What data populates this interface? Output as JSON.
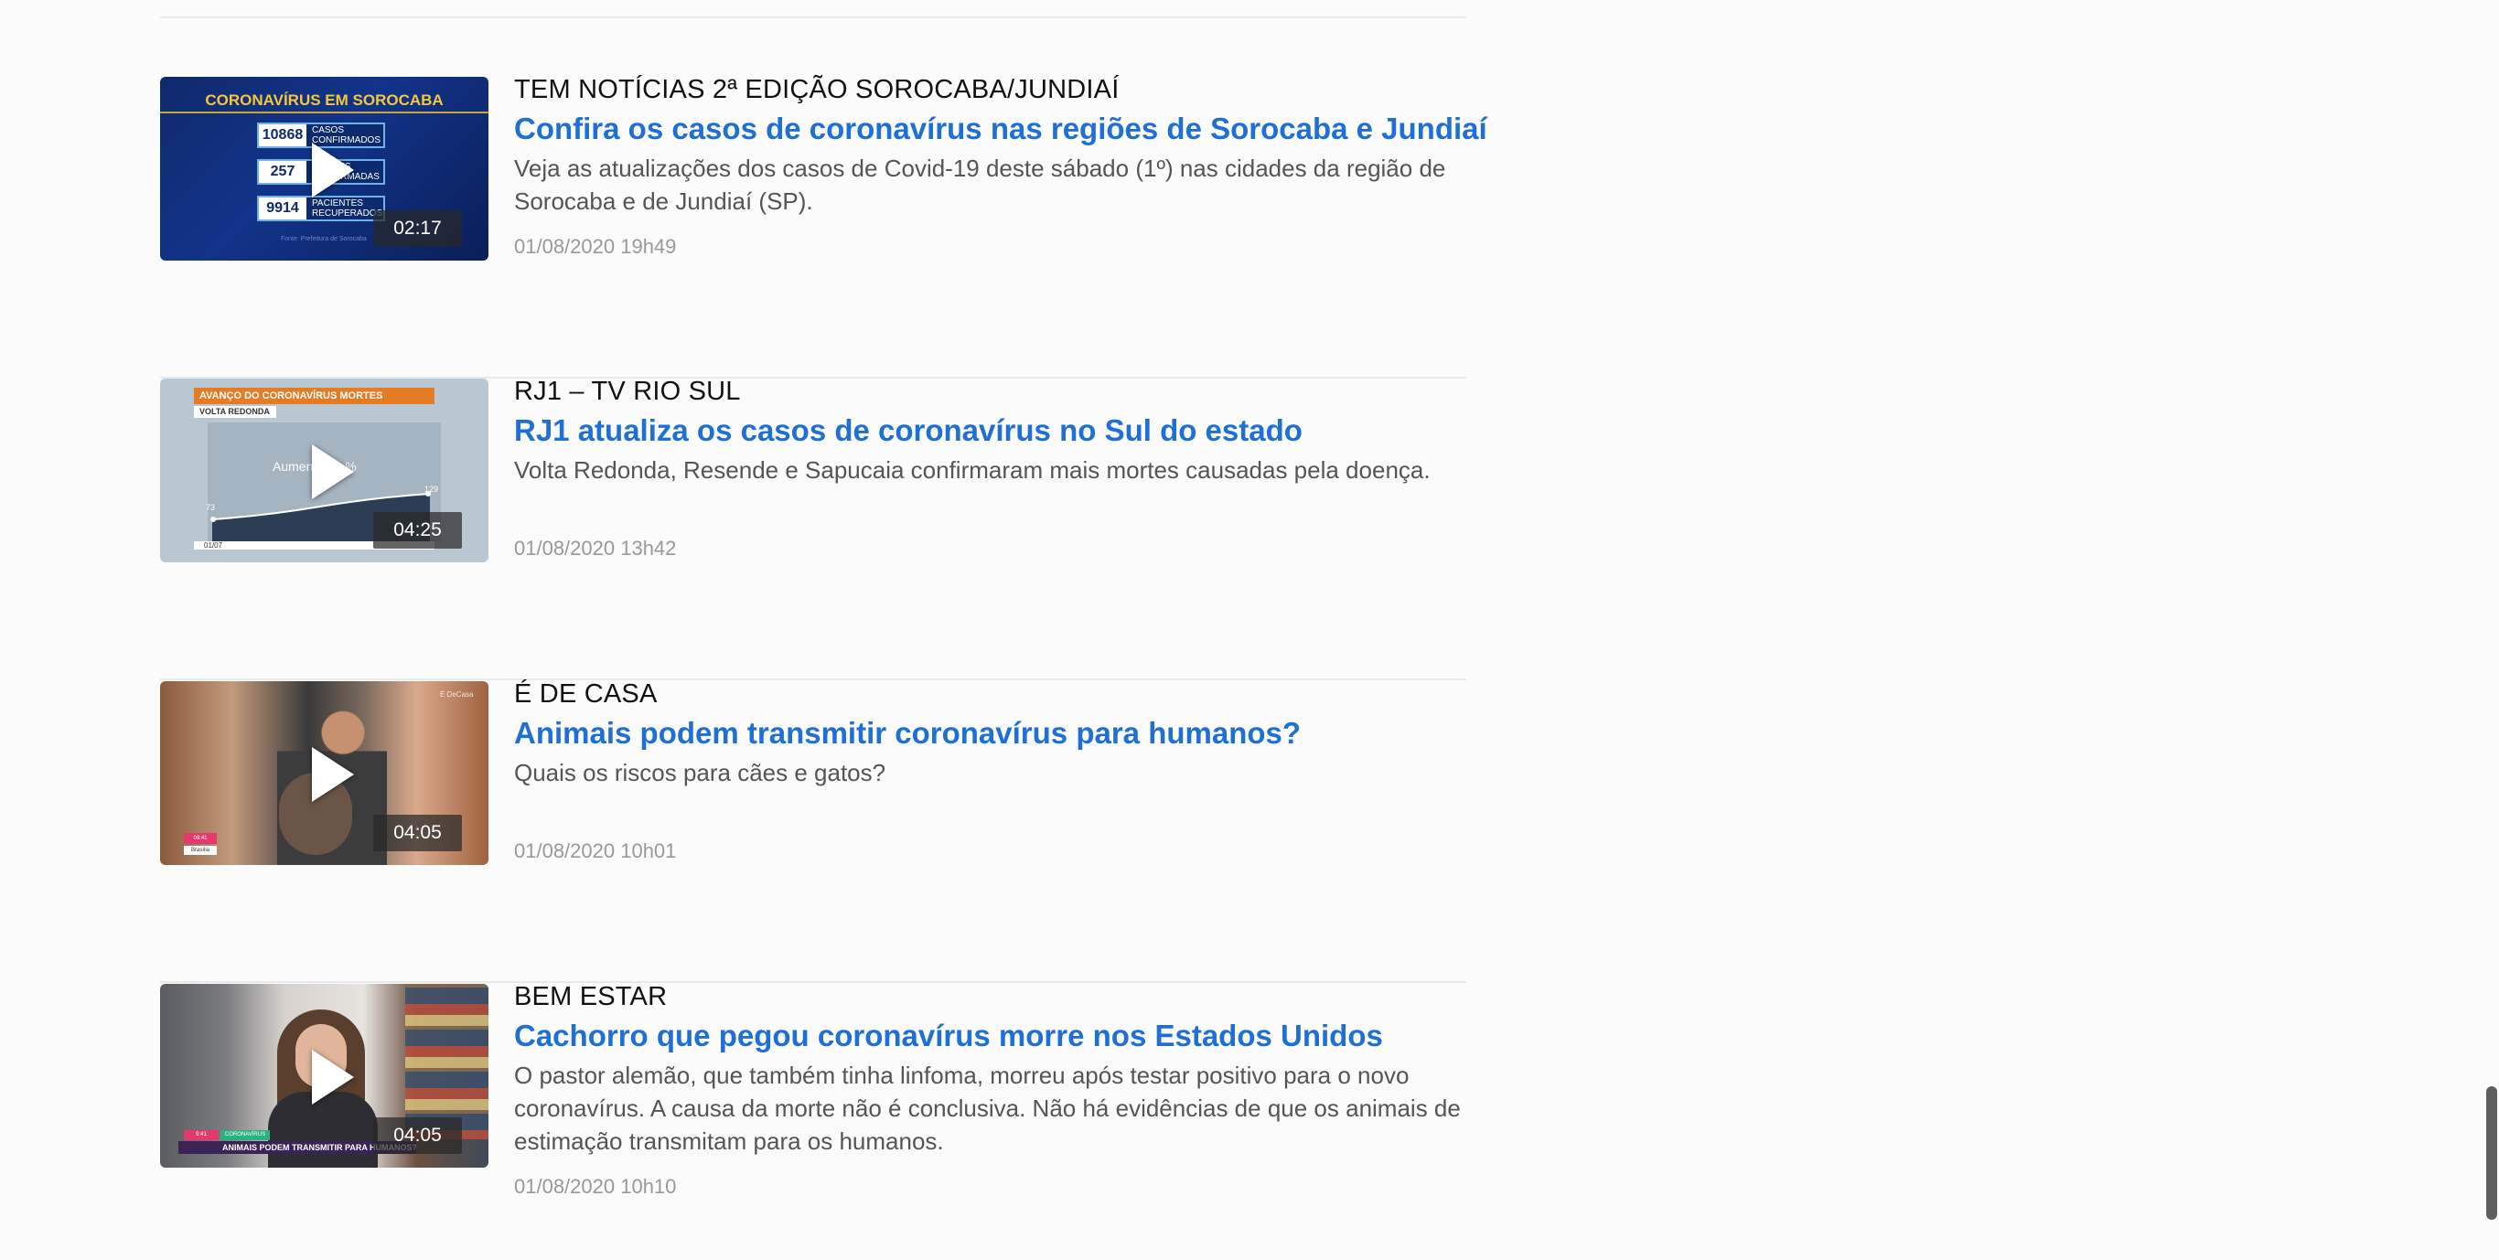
{
  "feed": {
    "items": [
      {
        "section": "TEM NOTÍCIAS 2ª EDIÇÃO SOROCABA/JUNDIAÍ",
        "headline": "Confira os casos de coronavírus nas regiões de Sorocaba e Jundiaí",
        "summary": "Veja as atualizações dos casos de Covid-19 deste sábado (1º) nas cidades da região de Sorocaba e de Jundiaí (SP).",
        "date": "01/08/2020 19h49",
        "duration": "02:17",
        "thumbnail": {
          "title": "CORONAVÍRUS EM SOROCABA",
          "stats": [
            {
              "value": "10868",
              "label": "CASOS CONFIRMADOS"
            },
            {
              "value": "257",
              "label": "MORTES CONFIRMADAS"
            },
            {
              "value": "9914",
              "label": "PACIENTES RECUPERADOS"
            }
          ],
          "source": "Fonte: Prefeitura de Sorocaba"
        }
      },
      {
        "section": "RJ1 – TV RIO SUL",
        "headline": "RJ1 atualiza os casos de coronavírus no Sul do estado",
        "summary": "Volta Redonda, Resende e Sapucaia confirmaram mais mortes causadas pela doença.",
        "date": "01/08/2020 13h42",
        "duration": "04:25",
        "thumbnail": {
          "banner": "AVANÇO DO CORONAVÍRUS MORTES",
          "city": "VOLTA REDONDA",
          "caption": "Aumento 76 %",
          "start_value": "73",
          "end_value": "129",
          "axis_label": "01/07"
        }
      },
      {
        "section": "É DE CASA",
        "headline": "Animais podem transmitir coronavírus para humanos?",
        "summary": "Quais os riscos para cães e gatos?",
        "date": "01/08/2020 10h01",
        "duration": "04:05",
        "thumbnail": {
          "watermark": "É DeCasa",
          "tag_time": "09:41",
          "tag_label": "Brasília"
        }
      },
      {
        "section": "BEM ESTAR",
        "headline": "Cachorro que pegou coronavírus morre nos Estados Unidos",
        "summary": "O pastor alemão, que também tinha linfoma, morreu após testar positivo para o novo coronavírus. A causa da morte não é conclusiva. Não há evidências de que os animais de estimação transmitam para os humanos.",
        "date": "01/08/2020 10h10",
        "duration": "04:05",
        "thumbnail": {
          "strip": "ANIMAIS PODEM TRANSMITIR PARA HUMANOS?",
          "tag_time": "9:41",
          "tag_label": "CORONAVÍRUS"
        }
      }
    ]
  },
  "theme": {
    "headline_color": "#1e6fd6",
    "section_color": "#111111",
    "summary_color": "#555555",
    "date_color": "#999999"
  },
  "icons": {
    "play": "play-icon"
  },
  "scrollbar": {
    "position": 0.95
  }
}
